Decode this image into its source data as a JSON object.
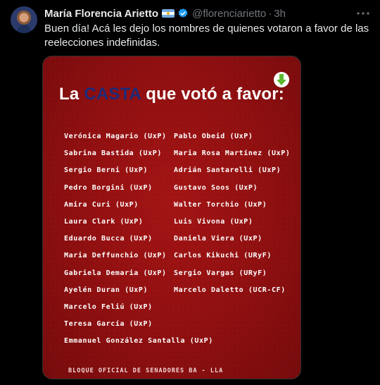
{
  "author": {
    "display_name": "María Florencia Arietto",
    "handle": "@florenciarietto",
    "separator": "·",
    "time": "3h"
  },
  "tweet": {
    "text": "Buen día! Acá les dejo los nombres de quienes votaron a favor de las reelecciones indefinidas."
  },
  "card": {
    "title_prefix": "La",
    "title_accent": "CASTA",
    "title_suffix": "que votó a favor:",
    "left_column": [
      "Verónica Magario (UxP)",
      "Sabrina Bastida (UxP)",
      "Sergio Berni (UxP)",
      "Pedro Borgini (UxP)",
      "Amira Curi (UxP)",
      "Laura Clark (UxP)",
      "Eduardo Bucca (UxP)",
      "Maria Deffunchio (UxP)",
      "Gabriela Demaria (UxP)",
      "Ayelén Duran (UxP)",
      "Marcelo Feliú (UxP)",
      "Teresa García (UxP)",
      "Emmanuel González Santalla (UxP)"
    ],
    "right_column": [
      "Pablo Obeid (UxP)",
      "Maria Rosa Martínez (UxP)",
      "Adrián Santarelli (UxP)",
      "Gustavo Soos (UxP)",
      "Walter Torchio (UxP)",
      "Luis Vivona (UxP)",
      "Daniela Viera (UxP)",
      "Carlos Kikuchi (URyF)",
      "Sergio Vargas (URyF)",
      "Marcelo Daletto (UCR-CF)"
    ],
    "footer": "BLOQUE OFICIAL DE SENADORES BA - LLA"
  },
  "colors": {
    "background": "#000000",
    "card_red": "#8e0f10",
    "accent_blue": "#1d2a79",
    "verified_blue": "#1d9bf0",
    "muted_text": "#71767b"
  },
  "icons": {
    "verified": "verified-badge-icon",
    "flag": "argentina-flag-icon",
    "more": "more-options-icon",
    "download": "green-down-arrow-icon"
  }
}
